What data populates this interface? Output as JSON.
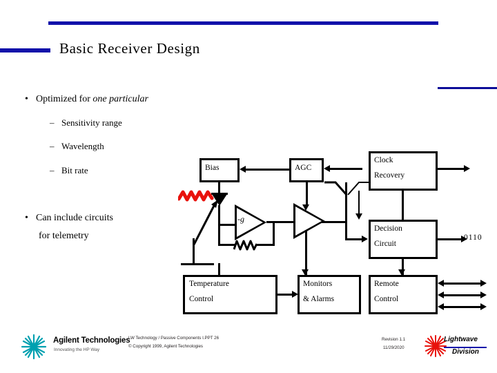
{
  "slide": {
    "title": "Basic Receiver Design",
    "bullets": [
      {
        "level": 1,
        "marker": "•",
        "text": "Optimized for ",
        "emphasis": "one particular"
      },
      {
        "level": 2,
        "marker": "–",
        "text": "Sensitivity range"
      },
      {
        "level": 2,
        "marker": "–",
        "text": "Wavelength"
      },
      {
        "level": 2,
        "marker": "–",
        "text": "Bit rate"
      },
      {
        "level": 1,
        "marker": "•",
        "text": "Can include circuits"
      },
      {
        "level": 1,
        "marker": "",
        "text": "for telemetry"
      }
    ]
  },
  "diagram": {
    "blocks": {
      "bias": "Bias",
      "agc": "AGC",
      "clock_line1": "Clock",
      "clock_line2": "Recovery",
      "decision_line1": "Decision",
      "decision_line2": "Circuit",
      "temperature_line1": "Temperature",
      "temperature_line2": "Control",
      "monitors_line1": "Monitors",
      "monitors_line2": "& Alarms",
      "remote_line1": "Remote",
      "remote_line2": "Control"
    },
    "amplifier_gain_label": "-g",
    "data_output_label": "0110"
  },
  "footer": {
    "company": "Agilent Technologies",
    "tagline": "Innovating the HP Way",
    "source_line1": "LW Technology / Passive Components I.PPT   26",
    "source_line2": "© Copyright 1999, Agilent Technologies",
    "revision": "Revision 1.1",
    "date": "11/29/2020",
    "division_line1": "Lightwave",
    "division_line2": "Division"
  },
  "colors": {
    "accent_blue": "#1111aa",
    "optical_red": "#e8120c",
    "ink": "#000000",
    "logo_teal": "#00a0b0"
  }
}
